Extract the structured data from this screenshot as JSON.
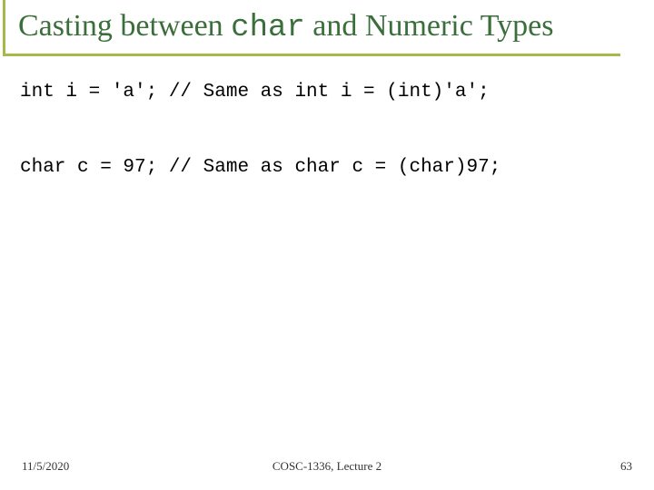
{
  "title": {
    "part1": "Casting between ",
    "mono": "char",
    "part2": " and Numeric Types"
  },
  "code": {
    "line1": "int i = 'a'; // Same as int i = (int)'a';",
    "line2": "char c = 97; // Same as char c = (char)97;"
  },
  "footer": {
    "date": "11/5/2020",
    "course": "COSC-1336, Lecture 2",
    "page": "63"
  }
}
